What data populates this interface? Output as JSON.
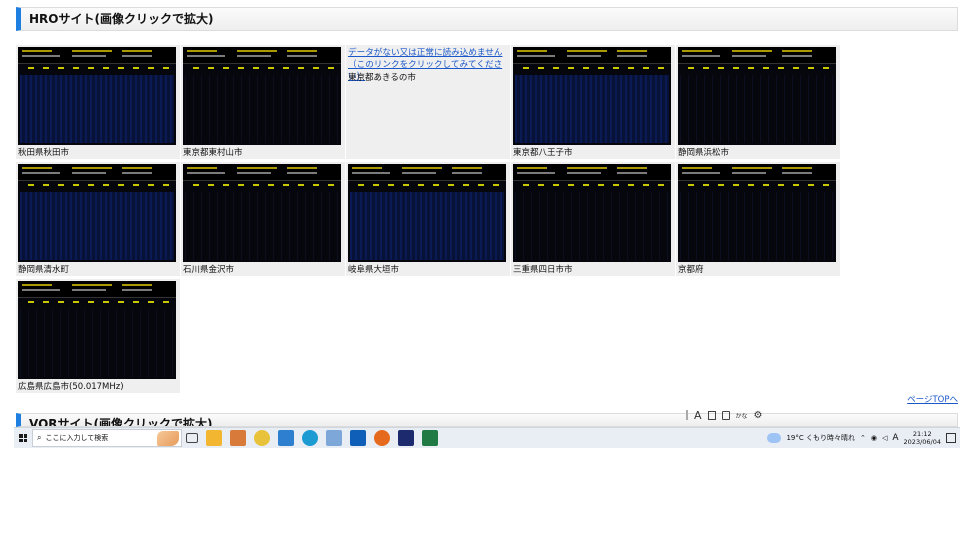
{
  "sections": {
    "hro_title": "HROサイト(画像クリックで拡大)",
    "vor_title": "VORサイト(画像クリックで拡大)"
  },
  "stations": [
    {
      "label": "秋田県秋田市",
      "status": "ok",
      "style": "blue"
    },
    {
      "label": "東京都東村山市",
      "status": "ok",
      "style": "dark"
    },
    {
      "label": "東京都あきるの市",
      "status": "nodata",
      "message": "データがない又は正常に読み込めません（このリンクをクリックしてみてください）"
    },
    {
      "label": "東京都八王子市",
      "status": "ok",
      "style": "blue"
    },
    {
      "label": "静岡県浜松市",
      "status": "ok",
      "style": "dark"
    },
    {
      "label": "静岡県清水町",
      "status": "ok",
      "style": "blue"
    },
    {
      "label": "石川県金沢市",
      "status": "ok",
      "style": "dark"
    },
    {
      "label": "岐阜県大垣市",
      "status": "ok",
      "style": "blue"
    },
    {
      "label": "三重県四日市市",
      "status": "ok",
      "style": "dark"
    },
    {
      "label": "京都府",
      "status": "ok",
      "style": "dark"
    },
    {
      "label": "広島県広島市(50.017MHz)",
      "status": "ok",
      "style": "dark"
    }
  ],
  "links": {
    "page_top": "ページTOPへ"
  },
  "ime": {
    "mode": "A",
    "kana": "かな"
  },
  "taskbar": {
    "search_placeholder": "ここに入力して検索",
    "weather": "19°C くもり時々晴れ",
    "lang": "A",
    "time": "21:12",
    "date": "2023/06/04"
  },
  "colors": {
    "accent": "#1e7fe0",
    "link": "#1a57c9"
  }
}
